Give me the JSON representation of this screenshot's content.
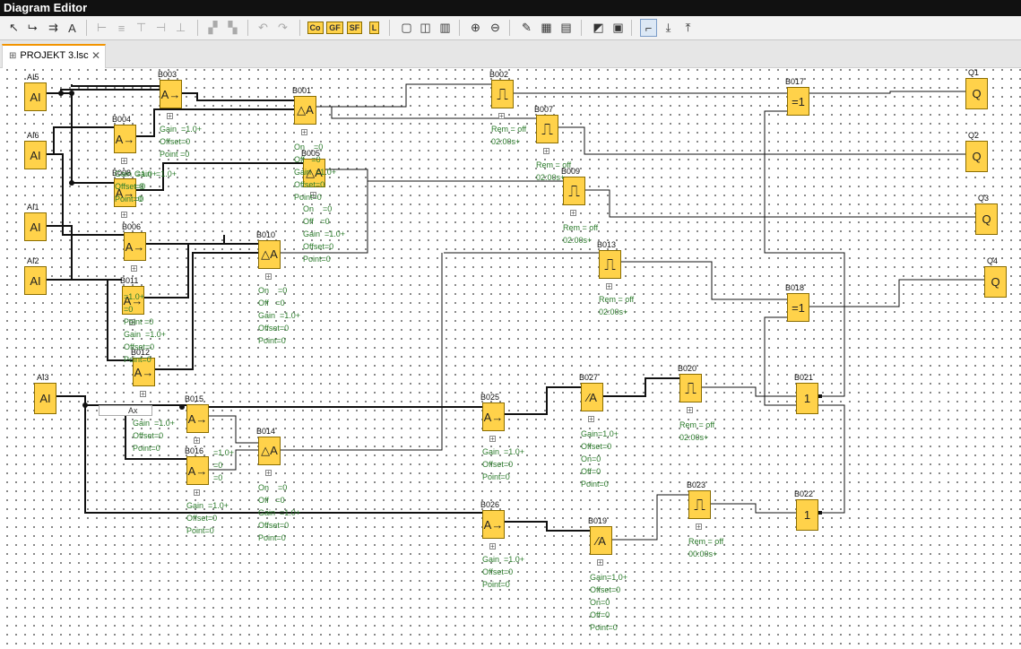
{
  "window_title": "Diagram Editor",
  "tab": {
    "name": "PROJEKT 3.lsc",
    "close": "✕"
  },
  "toolbar": {
    "buttons": [
      {
        "icon": "select-arrow-icon",
        "glyph": "↖"
      },
      {
        "icon": "connect-icon",
        "glyph": "⮡"
      },
      {
        "icon": "block-insert-icon",
        "glyph": "⇉"
      },
      {
        "icon": "text-tool-icon",
        "glyph": "A"
      },
      {
        "icon": "align-left-icon",
        "glyph": "⊢",
        "dim": true
      },
      {
        "icon": "align-center-icon",
        "glyph": "≡",
        "dim": true
      },
      {
        "icon": "align-top-icon",
        "glyph": "⊤",
        "dim": true
      },
      {
        "icon": "distribute-h-icon",
        "glyph": "⊣",
        "dim": true
      },
      {
        "icon": "distribute-v-icon",
        "glyph": "⊥",
        "dim": true
      },
      {
        "icon": "cut-icon",
        "glyph": "▞",
        "dim": true
      },
      {
        "icon": "copy-icon",
        "glyph": "▚",
        "dim": true
      },
      {
        "icon": "undo-icon",
        "glyph": "↶",
        "dim": true
      },
      {
        "icon": "redo-icon",
        "glyph": "↷",
        "dim": true
      },
      {
        "icon": "constants-co-icon",
        "text": "Co"
      },
      {
        "icon": "basic-functions-gf-icon",
        "text": "GF"
      },
      {
        "icon": "special-functions-sf-icon",
        "text": "SF"
      },
      {
        "icon": "label-l-icon",
        "text": "L"
      },
      {
        "icon": "page-single-icon",
        "glyph": "▢"
      },
      {
        "icon": "page-split-icon",
        "glyph": "◫"
      },
      {
        "icon": "page-triple-icon",
        "glyph": "▥"
      },
      {
        "icon": "zoom-in-icon",
        "glyph": "⊕"
      },
      {
        "icon": "zoom-out-icon",
        "glyph": "⊖"
      },
      {
        "icon": "highlight-icon",
        "glyph": "✎"
      },
      {
        "icon": "grid-icon",
        "glyph": "▦"
      },
      {
        "icon": "table-icon",
        "glyph": "▤"
      },
      {
        "icon": "simulation-icon",
        "glyph": "◩"
      },
      {
        "icon": "online-test-icon",
        "glyph": "▣"
      },
      {
        "icon": "route-icon",
        "glyph": "⌐"
      },
      {
        "icon": "download-icon",
        "glyph": "⤓"
      },
      {
        "icon": "upload-icon",
        "glyph": "⤒"
      }
    ]
  },
  "diagram": {
    "blocks": [
      {
        "id": "AI5",
        "label": "AI5",
        "symbol": "AI"
      },
      {
        "id": "AI6",
        "label": "AI6",
        "symbol": "AI"
      },
      {
        "id": "AI1",
        "label": "AI1",
        "symbol": "AI"
      },
      {
        "id": "AI2",
        "label": "AI2",
        "symbol": "AI"
      },
      {
        "id": "AI3",
        "label": "AI3",
        "symbol": "AI"
      },
      {
        "id": "B003",
        "label": "B003",
        "symbol": "A→"
      },
      {
        "id": "B004",
        "label": "B004",
        "symbol": "A→"
      },
      {
        "id": "B008",
        "label": "B008",
        "symbol": "A→"
      },
      {
        "id": "B006",
        "label": "B006",
        "symbol": "A→"
      },
      {
        "id": "B011",
        "label": "B011",
        "symbol": "A→"
      },
      {
        "id": "B012",
        "label": "B012",
        "symbol": "A→"
      },
      {
        "id": "B001",
        "label": "B001",
        "symbol": "△A"
      },
      {
        "id": "B005",
        "label": "B005",
        "symbol": "△A"
      },
      {
        "id": "B010",
        "label": "B010",
        "symbol": "△A"
      },
      {
        "id": "B002",
        "label": "B002",
        "symbol": "⎍"
      },
      {
        "id": "B007",
        "label": "B007",
        "symbol": "⎍"
      },
      {
        "id": "B009",
        "label": "B009",
        "symbol": "⎍"
      },
      {
        "id": "B013",
        "label": "B013",
        "symbol": "⎍"
      },
      {
        "id": "B015",
        "label": "B015",
        "symbol": "A→"
      },
      {
        "id": "B016",
        "label": "B016",
        "symbol": "A→"
      },
      {
        "id": "B014",
        "label": "B014",
        "symbol": "△A"
      },
      {
        "id": "B025",
        "label": "B025",
        "symbol": "A→"
      },
      {
        "id": "B026",
        "label": "B026",
        "symbol": "A→"
      },
      {
        "id": "B027",
        "label": "B027",
        "symbol": "⁄A"
      },
      {
        "id": "B019",
        "label": "B019",
        "symbol": "⁄A"
      },
      {
        "id": "B020",
        "label": "B020",
        "symbol": "⎍"
      },
      {
        "id": "B023",
        "label": "B023",
        "symbol": "⎍"
      },
      {
        "id": "B017",
        "label": "B017",
        "symbol": "=1"
      },
      {
        "id": "B018",
        "label": "B018",
        "symbol": "=1"
      },
      {
        "id": "B021",
        "label": "B021",
        "symbol": "1"
      },
      {
        "id": "B022",
        "label": "B022",
        "symbol": "1"
      },
      {
        "id": "Q1",
        "label": "Q1",
        "symbol": "Q"
      },
      {
        "id": "Q2",
        "label": "Q2",
        "symbol": "Q"
      },
      {
        "id": "Q3",
        "label": "Q3",
        "symbol": "Q"
      },
      {
        "id": "Q4",
        "label": "Q4",
        "symbol": "Q"
      }
    ],
    "params": [
      {
        "block": "B003",
        "text": "Gain  =1.0+\nOffset=0\nPoint =0"
      },
      {
        "block": "B004",
        "text": "Gain  =1.0+\n=0\n=0"
      },
      {
        "block": "B008",
        "text": "Gain  =1.0+\nOffset=0\nPoint=0"
      },
      {
        "block": "B001",
        "text": "On    =0\nOff   =0\nGain  =1.0+\nOffset=0\nPoint=0"
      },
      {
        "block": "B005",
        "text": "On    =0\nOff   =0\nGain  =1.0+\nOffset=0\nPoint=0"
      },
      {
        "block": "B010",
        "text": "On    =0\nOff   =0\nGain  =1.0+\nOffset=0\nPoint=0"
      },
      {
        "block": "B011",
        "text": "=1.0+\n=0\nPoint =0\nGain  =1.0+\nOffset=0\nPoint=0"
      },
      {
        "block": "B002",
        "text": "Rem = off\n02:00s+"
      },
      {
        "block": "B007",
        "text": "Rem = off\n02:00s+"
      },
      {
        "block": "B009",
        "text": "Rem = off\n02:00s+"
      },
      {
        "block": "B013",
        "text": "Rem = off\n02:00s+"
      },
      {
        "block": "B015",
        "text": "Gain  =1.0+\nOffset=0\nPoint=0"
      },
      {
        "block": "B016",
        "text": "=1.0+\n=0\n=0"
      },
      {
        "block": "B016b",
        "text": "Gain  =1.0+\nOffset=0\nPoint=0"
      },
      {
        "block": "B014",
        "text": "On    =0\nOff   =0\nGain  =1.0+\nOffset=0\nPoint=0"
      },
      {
        "block": "B025",
        "text": "Gain  =1.0+\nOffset=0\nPoint=0"
      },
      {
        "block": "B026",
        "text": "Gain  =1.0+\nOffset=0\nPoint=0"
      },
      {
        "block": "B027",
        "text": "Gain=1.0+\nOffset=0\nOn=0\nOff=0\nPoint=0"
      },
      {
        "block": "B019",
        "text": "Gain=1.0+\nOffset=0\nOn=0\nOff=0\nPoint=0"
      },
      {
        "block": "B020",
        "text": "Rem = off\n02:00s+"
      },
      {
        "block": "B023",
        "text": "Rem = off\n00:00s+"
      }
    ],
    "field_text": "Ax"
  }
}
